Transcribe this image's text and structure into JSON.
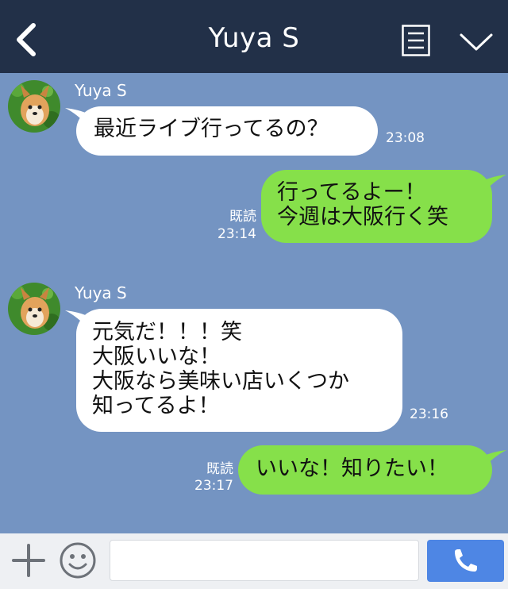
{
  "header": {
    "title": "Yuya S"
  },
  "messages": [
    {
      "side": "in",
      "sender": "Yuya S",
      "text": "最近ライブ行ってるの？",
      "time": "23:08"
    },
    {
      "side": "out",
      "text": "行ってるよー！\n今週は大阪行く笑",
      "read": "既読",
      "time": "23:14"
    },
    {
      "side": "in",
      "sender": "Yuya S",
      "text": "元気だ！！！笑\n大阪いいな！\n大阪なら美味い店いくつか\n知ってるよ！",
      "time": "23:16"
    },
    {
      "side": "out",
      "text": "いいな！知りたい！",
      "read": "既読",
      "time": "23:17"
    }
  ],
  "footer": {
    "input_value": "",
    "input_placeholder": ""
  },
  "icons": {
    "back": "back-chevron-icon",
    "menu": "note-icon",
    "collapse": "chevron-down-icon",
    "add": "plus-icon",
    "sticker": "smiley-icon",
    "call": "phone-icon"
  },
  "colors": {
    "header": "#223048",
    "background": "#7494c2",
    "outgoing_bubble": "#86e04a",
    "incoming_bubble": "#ffffff",
    "call_button": "#4e86e4"
  }
}
